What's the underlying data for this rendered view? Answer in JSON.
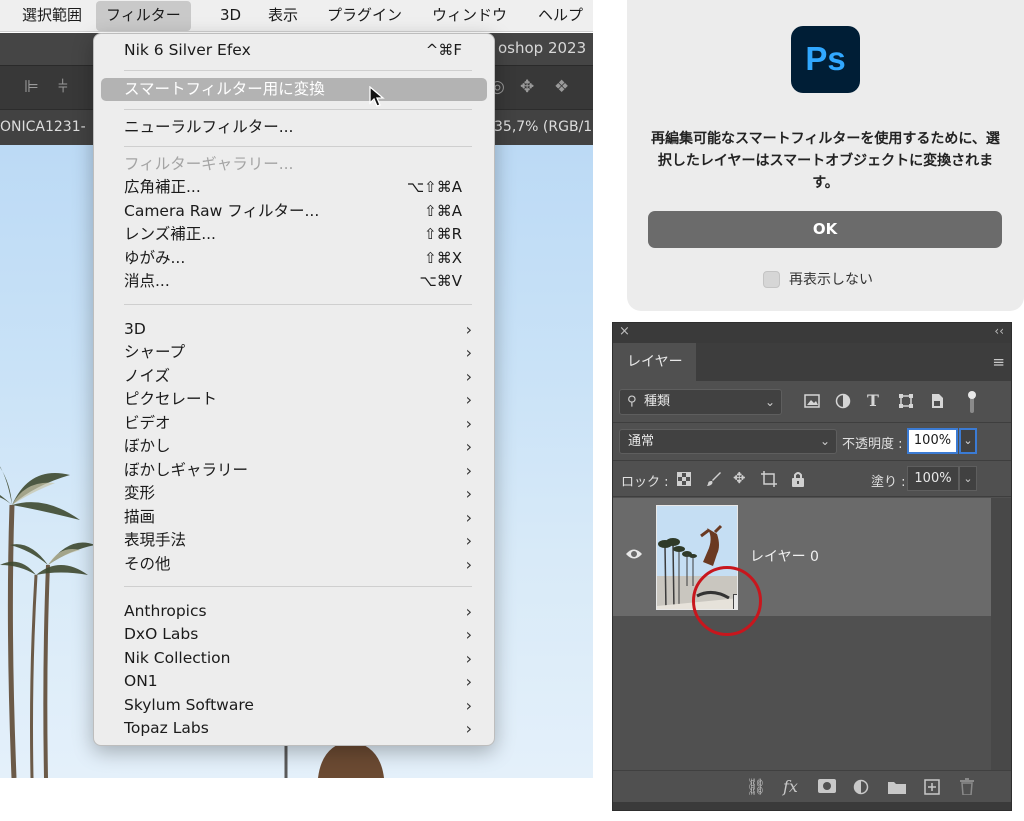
{
  "menubar": {
    "items": [
      "選択範囲",
      "フィルター",
      "3D",
      "表示",
      "プラグイン",
      "ウィンドウ",
      "ヘルプ"
    ],
    "active": "フィルター"
  },
  "titlebar": {
    "text": "oshop 2023"
  },
  "document_tab": {
    "name": "ONICA1231-",
    "zoom": "35,7% (RGB/1"
  },
  "filter_menu": {
    "item_last_filter": {
      "label": "Nik 6 Silver Efex",
      "shortcut": "^⌘F"
    },
    "item_convert_smart": {
      "label": "スマートフィルター用に変換"
    },
    "item_neural": {
      "label": "ニューラルフィルター..."
    },
    "item_gallery": {
      "label": "フィルターギャラリー..."
    },
    "item_wide_angle": {
      "label": "広角補正...",
      "shortcut": "⌥⇧⌘A"
    },
    "item_camera_raw": {
      "label": "Camera Raw フィルター...",
      "shortcut": "⇧⌘A"
    },
    "item_lens": {
      "label": "レンズ補正...",
      "shortcut": "⇧⌘R"
    },
    "item_liquify": {
      "label": "ゆがみ...",
      "shortcut": "⇧⌘X"
    },
    "item_vanishing": {
      "label": "消点...",
      "shortcut": "⌥⌘V"
    },
    "submenus": [
      "3D",
      "シャープ",
      "ノイズ",
      "ピクセレート",
      "ビデオ",
      "ぼかし",
      "ぼかしギャラリー",
      "変形",
      "描画",
      "表現手法",
      "その他"
    ],
    "plugins": [
      "Anthropics",
      "DxO Labs",
      "Nik Collection",
      "ON1",
      "Skylum Software",
      "Topaz Labs"
    ],
    "submenu_arrow": "›"
  },
  "dialog": {
    "logo_text": "Ps",
    "message": "再編集可能なスマートフィルターを使用するために、選択したレイヤーはスマートオブジェクトに変換されます。",
    "ok_label": "OK",
    "dont_show_label": "再表示しない"
  },
  "layers_panel": {
    "close": "×",
    "collapse": "‹‹",
    "tab_label": "レイヤー",
    "menu_icon": "≡",
    "kind_filter": "種類",
    "blend_mode": "通常",
    "opacity_label": "不透明度 :",
    "opacity_value": "100%",
    "lock_label": "ロック :",
    "fill_label": "塗り :",
    "fill_value": "100%",
    "layer_name": "レイヤー 0",
    "chevron": "⌄"
  },
  "colors": {
    "ps_logo_bg": "#001e36",
    "ps_logo_text": "#31a8ff",
    "highlight_circle": "#c8161d",
    "focus_border": "#3b7bd4"
  }
}
